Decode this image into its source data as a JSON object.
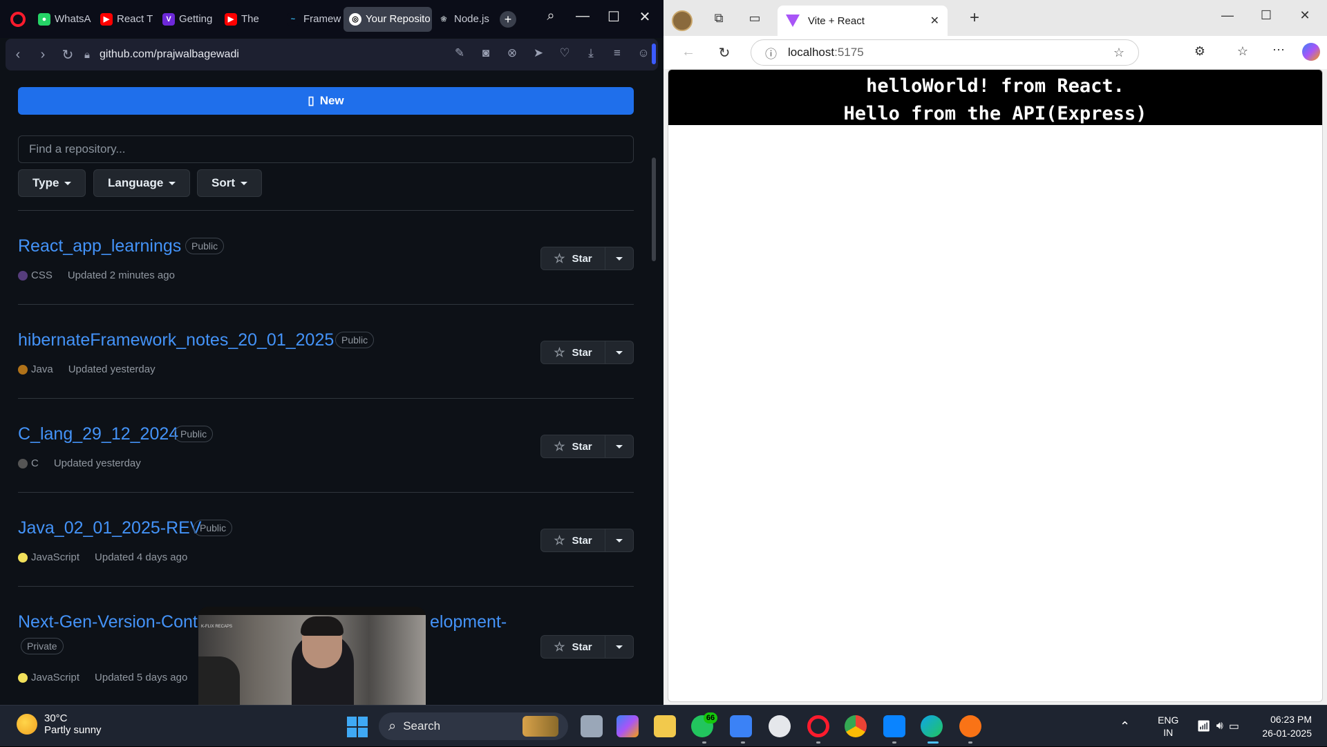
{
  "opera": {
    "tabs": [
      {
        "label": "WhatsA",
        "color": "#25d366",
        "glyph": "●"
      },
      {
        "label": "React T",
        "color": "#ff0000",
        "glyph": "▶"
      },
      {
        "label": "Getting",
        "color": "#a855f7",
        "glyph": "V"
      },
      {
        "label": "The",
        "color": "#ff0000",
        "glyph": "▶"
      },
      {
        "label": "Framew",
        "color": "#38bdf8",
        "glyph": "~"
      },
      {
        "label": "Your Reposito",
        "color": "#ffffff",
        "glyph": "◎"
      },
      {
        "label": "Node.js",
        "color": "#9aa0a6",
        "glyph": "❀"
      }
    ],
    "url": "github.com/prajwalbagewadi"
  },
  "github": {
    "new_button": "New",
    "search_placeholder": "Find a repository...",
    "filters": [
      "Type",
      "Language",
      "Sort"
    ],
    "repos": [
      {
        "name": "React_app_learnings",
        "visibility": "Public",
        "language": "CSS",
        "lang_color": "#563d7c",
        "updated": "Updated 2 minutes ago"
      },
      {
        "name": "hibernateFramework_notes_20_01_2025",
        "visibility": "Public",
        "language": "Java",
        "lang_color": "#b07219",
        "updated": "Updated yesterday"
      },
      {
        "name": "C_lang_29_12_2024",
        "visibility": "Public",
        "language": "C",
        "lang_color": "#555555",
        "updated": "Updated yesterday"
      },
      {
        "name": "Java_02_01_2025-REV",
        "visibility": "Public",
        "language": "JavaScript",
        "lang_color": "#f1e05a",
        "updated": "Updated 4 days ago"
      },
      {
        "name_left": "Next-Gen-Version-Cont",
        "name_right": "elopment-",
        "visibility": "Private",
        "language": "JavaScript",
        "lang_color": "#f1e05a",
        "updated": "Updated 5 days ago"
      }
    ],
    "star_label": "Star",
    "pip_caption": "K-FLIX RECAPS"
  },
  "edge": {
    "tab_title": "Vite + React",
    "url_host": "localhost",
    "url_port": ":5175",
    "content_line1": "helloWorld! from React.",
    "content_line2": "Hello from the API(Express)"
  },
  "taskbar": {
    "temperature": "30°C",
    "weather": "Partly sunny",
    "search_label": "Search",
    "notification_count": "66",
    "lang1": "ENG",
    "lang2": "IN",
    "time": "06:23 PM",
    "date": "26-01-2025"
  }
}
